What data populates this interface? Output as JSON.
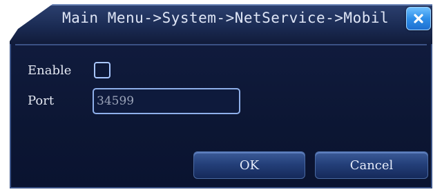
{
  "window": {
    "title": "Main Menu->System->NetService->Mobil",
    "close_icon": "close-icon"
  },
  "form": {
    "enable_label": "Enable",
    "enable_checked": false,
    "port_label": "Port",
    "port_value": "34599"
  },
  "buttons": {
    "ok_label": "OK",
    "cancel_label": "Cancel"
  },
  "colors": {
    "panel_bg": "#0c1633",
    "accent_border": "#8fb0ea",
    "close_button": "#2f8ee8"
  }
}
